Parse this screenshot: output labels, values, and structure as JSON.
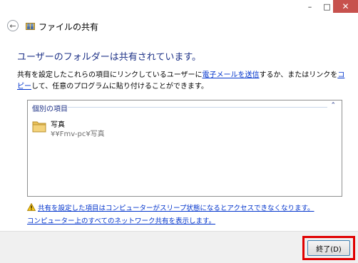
{
  "window": {
    "min_glyph": "–",
    "max_glyph": "□",
    "close_glyph": "✕"
  },
  "header": {
    "back_glyph": "←",
    "title": "ファイルの共有"
  },
  "main": {
    "heading": "ユーザーのフォルダーは共有されています。",
    "description": {
      "part1": "共有を設定したこれらの項目にリンクしているユーザーに",
      "link_email": "電子メールを送信",
      "part2": "するか、またはリンクを",
      "link_copy": "コピー",
      "part3": "して、任意のプログラムに貼り付けることができます。"
    }
  },
  "items_box": {
    "group_label": "個別の項目",
    "collapse_glyph": "⌃",
    "items": [
      {
        "name": "写真",
        "path": "¥¥Fmv-pc¥写真"
      }
    ]
  },
  "links": {
    "warning": "共有を設定した項目はコンピューターがスリープ状態になるとアクセスできなくなります。",
    "all_shares": "コンピューター上のすべてのネットワーク共有を表示します。"
  },
  "footer": {
    "finish_label": "終了(D)"
  },
  "colors": {
    "heading_blue": "#1e3287",
    "link_blue": "#0033cc",
    "close_red": "#c7514d",
    "highlight_red": "#e00000"
  }
}
